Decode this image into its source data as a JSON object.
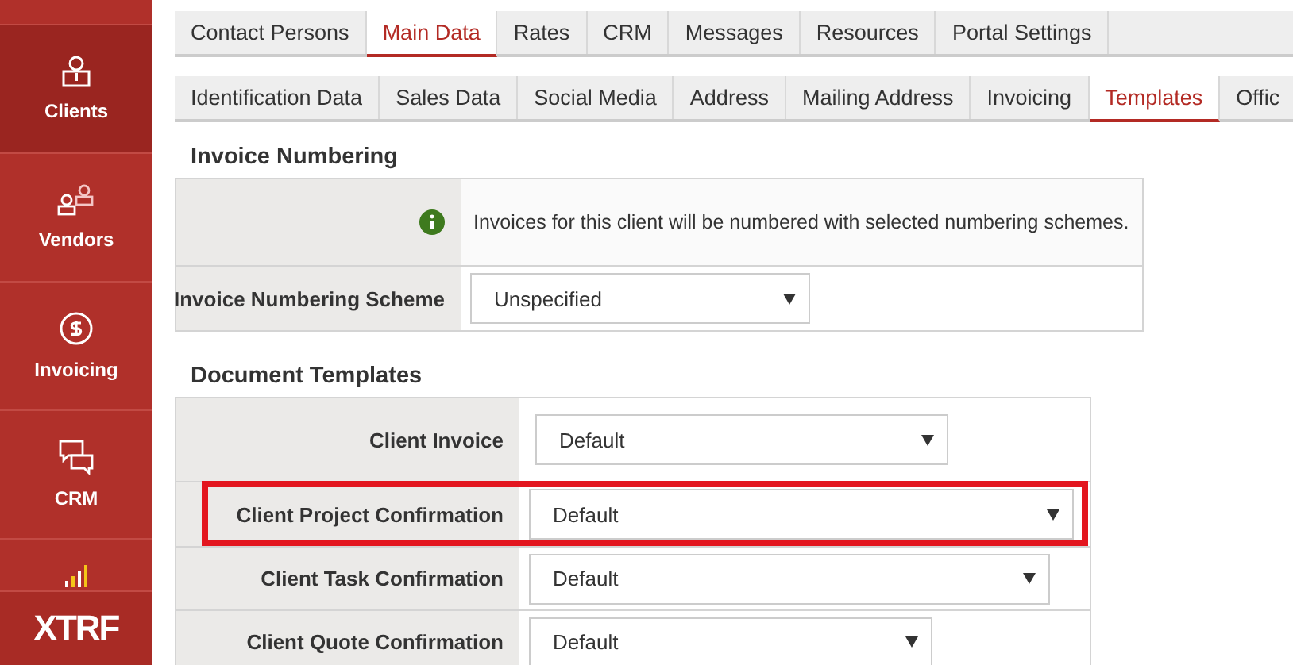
{
  "sidebar": {
    "items": [
      {
        "label": "Clients",
        "selected": true
      },
      {
        "label": "Vendors",
        "selected": false
      },
      {
        "label": "Invoicing",
        "selected": false
      },
      {
        "label": "CRM",
        "selected": false
      },
      {
        "selected": false
      }
    ],
    "logo": "XTRF"
  },
  "tabs": [
    {
      "label": "Contact Persons",
      "selected": false
    },
    {
      "label": "Main Data",
      "selected": true
    },
    {
      "label": "Rates",
      "selected": false
    },
    {
      "label": "CRM",
      "selected": false
    },
    {
      "label": "Messages",
      "selected": false
    },
    {
      "label": "Resources",
      "selected": false
    },
    {
      "label": "Portal Settings",
      "selected": false
    }
  ],
  "subtabs": [
    {
      "label": "Identification Data",
      "selected": false
    },
    {
      "label": "Sales Data",
      "selected": false
    },
    {
      "label": "Social Media",
      "selected": false
    },
    {
      "label": "Address",
      "selected": false
    },
    {
      "label": "Mailing Address",
      "selected": false
    },
    {
      "label": "Invoicing",
      "selected": false
    },
    {
      "label": "Templates",
      "selected": true
    },
    {
      "label": "Offic",
      "selected": false
    }
  ],
  "sections": [
    {
      "title": "Invoice Numbering",
      "rows": [
        {
          "kind": "info",
          "text": "Invoices for this client will be numbered with selected numbering schemes."
        },
        {
          "kind": "select",
          "label": "Invoice Numbering Scheme",
          "value": "Unspecified",
          "highlighted": false
        }
      ]
    },
    {
      "title": "Document Templates",
      "rows": [
        {
          "kind": "select",
          "label": "Client Invoice",
          "value": "Default",
          "highlighted": false
        },
        {
          "kind": "select",
          "label": "Client Project Confirmation",
          "value": "Default",
          "highlighted": true
        },
        {
          "kind": "select",
          "label": "Client Task Confirmation",
          "value": "Default",
          "highlighted": false
        },
        {
          "kind": "select",
          "label": "Client Quote Confirmation",
          "value": "Default",
          "highlighted": false
        }
      ]
    }
  ]
}
